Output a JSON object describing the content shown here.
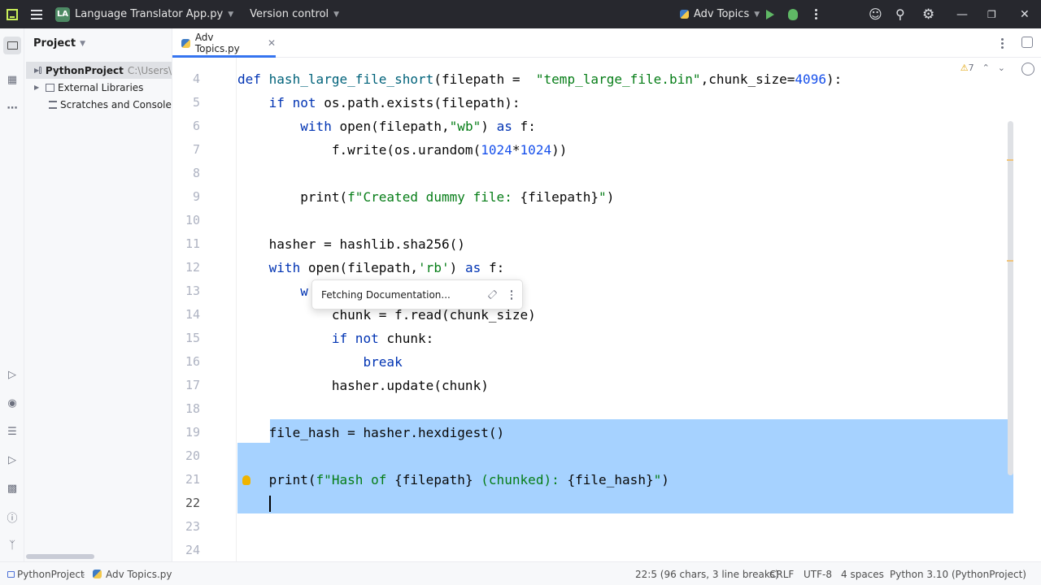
{
  "titlebar": {
    "project_badge": "LA",
    "project_name": "Language Translator App.py",
    "vcs": "Version control",
    "run_config": "Adv Topics"
  },
  "sidebar": {
    "title": "Project",
    "tree": [
      {
        "label": "PythonProject",
        "path": "C:\\Users\\"
      },
      {
        "label": "External Libraries"
      },
      {
        "label": "Scratches and Consoles"
      }
    ]
  },
  "editor": {
    "tab_label": "Adv Topics.py",
    "inspection_count": "7",
    "lines": [
      {
        "n": "4",
        "tokens": [
          [
            "kw",
            "def "
          ],
          [
            "fn",
            "hash_large_file_short"
          ],
          [
            "",
            "(filepath =  "
          ],
          [
            "str",
            "\"temp_large_file.bin\""
          ],
          [
            "",
            ",chunk_size="
          ],
          [
            "num",
            "4096"
          ],
          [
            "",
            "):"
          ]
        ]
      },
      {
        "n": "5",
        "tokens": [
          [
            "",
            "    "
          ],
          [
            "kw",
            "if not "
          ],
          [
            "",
            "os.path.exists(filepath):"
          ]
        ]
      },
      {
        "n": "6",
        "tokens": [
          [
            "",
            "        "
          ],
          [
            "kw",
            "with "
          ],
          [
            "",
            "open(filepath,"
          ],
          [
            "str",
            "\"wb\""
          ],
          [
            "",
            ") "
          ],
          [
            "kw",
            "as "
          ],
          [
            "",
            "f:"
          ]
        ]
      },
      {
        "n": "7",
        "tokens": [
          [
            "",
            "            f.write(os.urandom("
          ],
          [
            "num",
            "1024"
          ],
          [
            "",
            "*"
          ],
          [
            "num",
            "1024"
          ],
          [
            "",
            "))"
          ]
        ]
      },
      {
        "n": "8",
        "tokens": []
      },
      {
        "n": "9",
        "tokens": [
          [
            "",
            "        print("
          ],
          [
            "str",
            "f\"Created dummy file: "
          ],
          [
            "",
            "{filepath}"
          ],
          [
            "str",
            "\""
          ],
          [
            "",
            ")"
          ]
        ]
      },
      {
        "n": "10",
        "tokens": []
      },
      {
        "n": "11",
        "tokens": [
          [
            "",
            "    hasher = hashlib.sha256()"
          ]
        ]
      },
      {
        "n": "12",
        "tokens": [
          [
            "",
            "    "
          ],
          [
            "kw",
            "with "
          ],
          [
            "",
            "open(filepath,"
          ],
          [
            "str",
            "'rb'"
          ],
          [
            "",
            ") "
          ],
          [
            "kw",
            "as "
          ],
          [
            "",
            "f:"
          ]
        ]
      },
      {
        "n": "13",
        "tokens": [
          [
            "",
            "        "
          ],
          [
            "kw",
            "w"
          ]
        ]
      },
      {
        "n": "14",
        "tokens": [
          [
            "",
            "            chunk = f.read(chunk_size)"
          ]
        ]
      },
      {
        "n": "15",
        "tokens": [
          [
            "",
            "            "
          ],
          [
            "kw",
            "if not "
          ],
          [
            "",
            "chunk:"
          ]
        ]
      },
      {
        "n": "16",
        "tokens": [
          [
            "",
            "                "
          ],
          [
            "kw",
            "break"
          ]
        ]
      },
      {
        "n": "17",
        "tokens": [
          [
            "",
            "            hasher.update(chunk)"
          ]
        ]
      },
      {
        "n": "18",
        "tokens": []
      },
      {
        "n": "19",
        "tokens": [
          [
            "",
            "    file_hash = hasher.hexdigest()"
          ]
        ]
      },
      {
        "n": "20",
        "tokens": []
      },
      {
        "n": "21",
        "tokens": [
          [
            "",
            "    print("
          ],
          [
            "str",
            "f\"Hash of "
          ],
          [
            "",
            "{filepath}"
          ],
          [
            "str",
            " (chunked): "
          ],
          [
            "",
            "{file_hash}"
          ],
          [
            "str",
            "\""
          ],
          [
            "",
            ")"
          ]
        ]
      },
      {
        "n": "22",
        "tokens": [
          [
            "",
            "    "
          ]
        ]
      },
      {
        "n": "23",
        "tokens": []
      },
      {
        "n": "24",
        "tokens": []
      }
    ],
    "popup_text": "Fetching Documentation..."
  },
  "statusbar": {
    "breadcrumb_project": "PythonProject",
    "breadcrumb_file": "Adv Topics.py",
    "position": "22:5 (96 chars, 3 line breaks)",
    "line_sep": "CRLF",
    "encoding": "UTF-8",
    "indent": "4 spaces",
    "interpreter": "Python 3.10 (PythonProject)"
  },
  "colors": {
    "accent": "#3574f0",
    "selection": "#a6d2ff",
    "keyword": "#0033b3",
    "string": "#067d17",
    "number": "#1750eb"
  }
}
